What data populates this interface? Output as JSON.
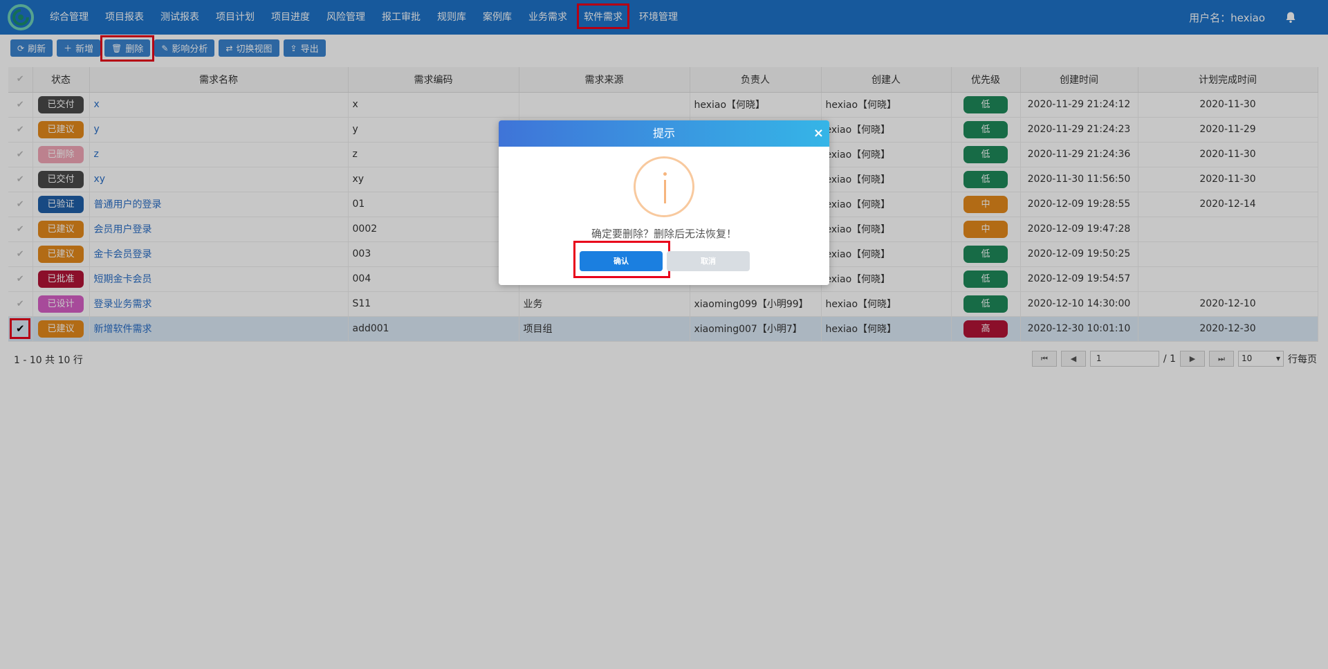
{
  "nav": {
    "items": [
      "综合管理",
      "项目报表",
      "测试报表",
      "项目计划",
      "项目进度",
      "风险管理",
      "报工审批",
      "规则库",
      "案例库",
      "业务需求",
      "软件需求",
      "环境管理"
    ],
    "active": "软件需求",
    "user_label": "用户名：hexiao"
  },
  "toolbar": {
    "refresh": "刷新",
    "add": "新增",
    "delete": "删除",
    "impact": "影响分析",
    "switch_view": "切换视图",
    "export": "导出"
  },
  "table": {
    "headers": [
      "状态",
      "需求名称",
      "需求编码",
      "需求来源",
      "负责人",
      "创建人",
      "优先级",
      "创建时间",
      "计划完成时间"
    ],
    "rows": [
      {
        "status": "已交付",
        "status_color": "#4a4a4a",
        "name": "x",
        "code": "x",
        "source": "",
        "owner": "hexiao【何晓】",
        "creator": "hexiao【何晓】",
        "priority": "低",
        "prio_color": "#1e8a5a",
        "created": "2020-11-29 21:24:12",
        "planned": "2020-11-30",
        "selected": false
      },
      {
        "status": "已建议",
        "status_color": "#e5891c",
        "name": "y",
        "code": "y",
        "source": "",
        "owner": "",
        "creator": "exiao【何晓】",
        "priority": "低",
        "prio_color": "#1e8a5a",
        "created": "2020-11-29 21:24:23",
        "planned": "2020-11-29",
        "selected": false
      },
      {
        "status": "已删除",
        "status_color": "#f1a6b6",
        "name": "z",
        "code": "z",
        "source": "",
        "owner": "",
        "creator": "exiao【何晓】",
        "priority": "低",
        "prio_color": "#1e8a5a",
        "created": "2020-11-29 21:24:36",
        "planned": "2020-11-30",
        "selected": false
      },
      {
        "status": "已交付",
        "status_color": "#4a4a4a",
        "name": "xy",
        "code": "xy",
        "source": "",
        "owner": "",
        "creator": "exiao【何晓】",
        "priority": "低",
        "prio_color": "#1e8a5a",
        "created": "2020-11-30 11:56:50",
        "planned": "2020-11-30",
        "selected": false
      },
      {
        "status": "已验证",
        "status_color": "#1f5fa8",
        "name": "普通用户的登录",
        "code": "01",
        "source": "",
        "owner": "",
        "creator": "exiao【何晓】",
        "priority": "中",
        "prio_color": "#e5891c",
        "created": "2020-12-09 19:28:55",
        "planned": "2020-12-14",
        "selected": false
      },
      {
        "status": "已建议",
        "status_color": "#e5891c",
        "name": "会员用户登录",
        "code": "0002",
        "source": "",
        "owner": "",
        "creator": "exiao【何晓】",
        "priority": "中",
        "prio_color": "#e5891c",
        "created": "2020-12-09 19:47:28",
        "planned": "",
        "selected": false
      },
      {
        "status": "已建议",
        "status_color": "#e5891c",
        "name": "金卡会员登录",
        "code": "003",
        "source": "",
        "owner": "",
        "creator": "exiao【何晓】",
        "priority": "低",
        "prio_color": "#1e8a5a",
        "created": "2020-12-09 19:50:25",
        "planned": "",
        "selected": false
      },
      {
        "status": "已批准",
        "status_color": "#b31437",
        "name": "短期金卡会员",
        "code": "004",
        "source": "",
        "owner": "",
        "creator": "exiao【何晓】",
        "priority": "低",
        "prio_color": "#1e8a5a",
        "created": "2020-12-09 19:54:57",
        "planned": "",
        "selected": false
      },
      {
        "status": "已设计",
        "status_color": "#d65fc6",
        "name": "登录业务需求",
        "code": "S11",
        "source": "业务",
        "owner": "xiaoming099【小明99】",
        "creator": "hexiao【何晓】",
        "priority": "低",
        "prio_color": "#1e8a5a",
        "created": "2020-12-10 14:30:00",
        "planned": "2020-12-10",
        "selected": false
      },
      {
        "status": "已建议",
        "status_color": "#e5891c",
        "name": "新增软件需求",
        "code": "add001",
        "source": "项目组",
        "owner": "xiaoming007【小明7】",
        "creator": "hexiao【何晓】",
        "priority": "高",
        "prio_color": "#b31437",
        "created": "2020-12-30 10:01:10",
        "planned": "2020-12-30",
        "selected": true
      }
    ]
  },
  "pager": {
    "info": "1 - 10 共 10 行",
    "page": "1",
    "total": "/ 1",
    "per_page": "10",
    "per_page_label": "行每页"
  },
  "dialog": {
    "title": "提示",
    "close": "×",
    "message": "确定要删除？删除后无法恢复！",
    "ok": "确认",
    "cancel": "取消"
  }
}
